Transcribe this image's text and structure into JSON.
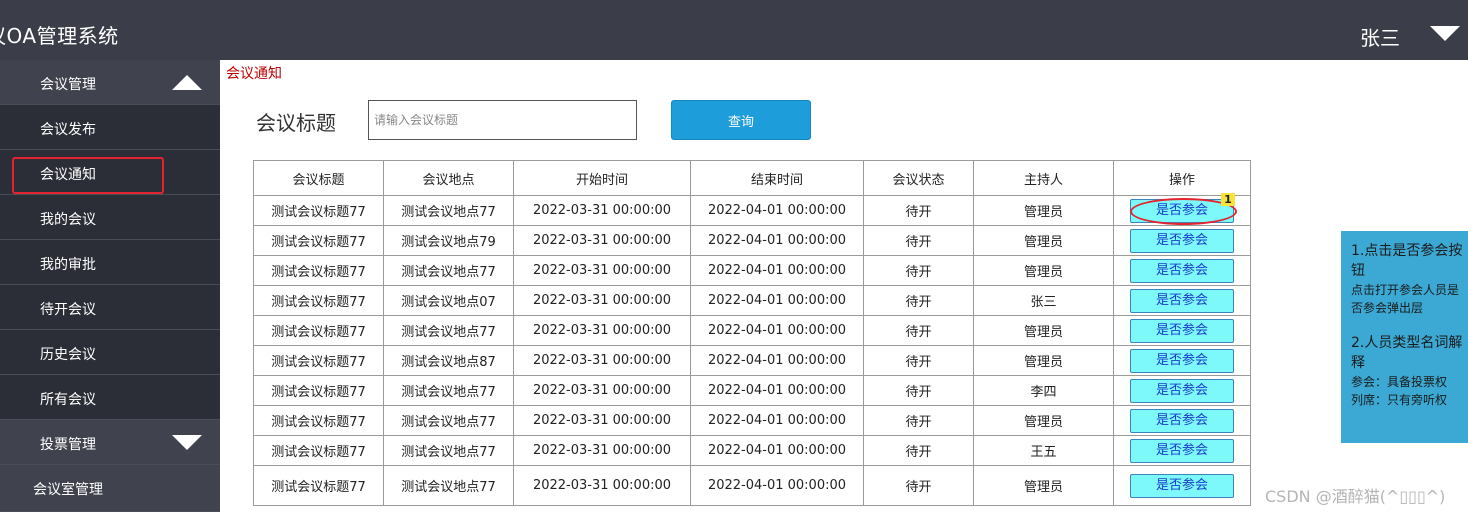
{
  "header": {
    "app_title": "议OA管理系统",
    "user_name": "张三",
    "user_menu_icon": "caret-down-icon"
  },
  "sidebar": {
    "items": [
      {
        "label": "会议管理",
        "type": "group",
        "icon": "triangle-up-icon"
      },
      {
        "label": "会议发布"
      },
      {
        "label": "会议通知",
        "active": true
      },
      {
        "label": "我的会议"
      },
      {
        "label": "我的审批"
      },
      {
        "label": "待开会议"
      },
      {
        "label": "历史会议"
      },
      {
        "label": "所有会议"
      },
      {
        "label": "投票管理",
        "type": "group",
        "icon": "triangle-down-icon"
      },
      {
        "label": "会议室管理"
      }
    ]
  },
  "breadcrumb": "会议通知",
  "search": {
    "label": "会议标题",
    "placeholder": "请输入会议标题",
    "value": "",
    "button": "查询"
  },
  "table": {
    "headers": [
      "会议标题",
      "会议地点",
      "开始时间",
      "结束时间",
      "会议状态",
      "主持人",
      "操作"
    ],
    "rows": [
      [
        "测试会议标题77",
        "测试会议地点77",
        "2022-03-31 00:00:00",
        "2022-04-01 00:00:00",
        "待开",
        "管理员",
        "是否参会"
      ],
      [
        "测试会议标题77",
        "测试会议地点79",
        "2022-03-31 00:00:00",
        "2022-04-01 00:00:00",
        "待开",
        "管理员",
        "是否参会"
      ],
      [
        "测试会议标题77",
        "测试会议地点77",
        "2022-03-31 00:00:00",
        "2022-04-01 00:00:00",
        "待开",
        "管理员",
        "是否参会"
      ],
      [
        "测试会议标题77",
        "测试会议地点07",
        "2022-03-31 00:00:00",
        "2022-04-01 00:00:00",
        "待开",
        "张三",
        "是否参会"
      ],
      [
        "测试会议标题77",
        "测试会议地点77",
        "2022-03-31 00:00:00",
        "2022-04-01 00:00:00",
        "待开",
        "管理员",
        "是否参会"
      ],
      [
        "测试会议标题77",
        "测试会议地点87",
        "2022-03-31 00:00:00",
        "2022-04-01 00:00:00",
        "待开",
        "管理员",
        "是否参会"
      ],
      [
        "测试会议标题77",
        "测试会议地点77",
        "2022-03-31 00:00:00",
        "2022-04-01 00:00:00",
        "待开",
        "李四",
        "是否参会"
      ],
      [
        "测试会议标题77",
        "测试会议地点77",
        "2022-03-31 00:00:00",
        "2022-04-01 00:00:00",
        "待开",
        "管理员",
        "是否参会"
      ],
      [
        "测试会议标题77",
        "测试会议地点77",
        "2022-03-31 00:00:00",
        "2022-04-01 00:00:00",
        "待开",
        "王五",
        "是否参会"
      ],
      [
        "测试会议标题77",
        "测试会议地点77",
        "2022-03-31 00:00:00",
        "2022-04-01 00:00:00",
        "待开",
        "管理员",
        "是否参会"
      ]
    ]
  },
  "annotation": {
    "badge": "1",
    "heading1": "1.点击是否参会按",
    "heading1b": "钮",
    "line1": "点击打开参会人员是",
    "line2": "否参会弹出层",
    "heading2": "2.人员类型名词解",
    "heading2b": "释",
    "line3": "参会：具备投票权",
    "line4": "列席：只有旁听权"
  },
  "watermark": "CSDN @酒醉猫(^▯▯▯^)",
  "colors": {
    "header_bg": "#3b3e48",
    "sidebar_bg": "#2b2e37",
    "highlight": "#e4232e",
    "button_blue": "#1e9ddb",
    "attend_button": "#7df9fc",
    "note_bg": "#3ba9d4"
  }
}
